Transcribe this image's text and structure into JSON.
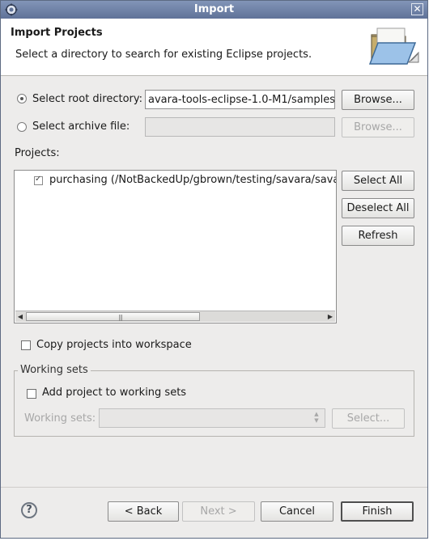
{
  "window": {
    "title": "Import",
    "close_glyph": "✕"
  },
  "header": {
    "title": "Import Projects",
    "description": "Select a directory to search for existing Eclipse projects."
  },
  "root_dir": {
    "label": "Select root directory:",
    "value": "avara-tools-eclipse-1.0-M1/samples",
    "browse": "Browse...",
    "selected": true
  },
  "archive": {
    "label": "Select archive file:",
    "value": "",
    "browse": "Browse...",
    "selected": false
  },
  "projects": {
    "label": "Projects:",
    "items": [
      {
        "label": "purchasing (/NotBackedUp/gbrown/testing/savara/savar",
        "checked": true
      }
    ],
    "select_all": "Select All",
    "deselect_all": "Deselect All",
    "refresh": "Refresh"
  },
  "copy_option": {
    "label": "Copy projects into workspace",
    "checked": false
  },
  "working_sets": {
    "group_label": "Working sets",
    "add_label": "Add project to working sets",
    "add_checked": false,
    "sets_label": "Working sets:",
    "sets_value": "",
    "select": "Select..."
  },
  "footer": {
    "help": "?",
    "back": "< Back",
    "next": "Next >",
    "cancel": "Cancel",
    "finish": "Finish"
  },
  "icons": {
    "window": "eclipse-gear-icon",
    "banner": "open-folder-icon",
    "help": "help-icon"
  },
  "colors": {
    "title_bar": "#6f82a8",
    "dialog_background": "#edeceb",
    "header_background": "#ffffff"
  }
}
